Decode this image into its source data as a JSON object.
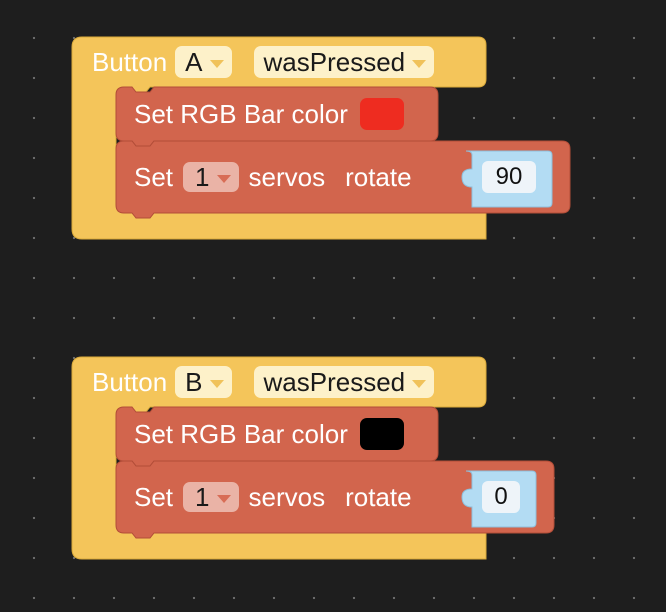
{
  "colors": {
    "event_block": "#f4c55a",
    "action_block": "#d2654d",
    "value_block": "#b3dcf3"
  },
  "blocks": [
    {
      "event": {
        "label": "Button",
        "button": "A",
        "action": "wasPressed"
      },
      "rgb": {
        "label": "Set RGB Bar color",
        "color": "#ee2c20"
      },
      "servo": {
        "set_label": "Set",
        "index": "1",
        "servos_label": "servos",
        "rotate_label": "rotate",
        "angle": "90"
      }
    },
    {
      "event": {
        "label": "Button",
        "button": "B",
        "action": "wasPressed"
      },
      "rgb": {
        "label": "Set RGB Bar color",
        "color": "#000000"
      },
      "servo": {
        "set_label": "Set",
        "index": "1",
        "servos_label": "servos",
        "rotate_label": "rotate",
        "angle": "0"
      }
    }
  ]
}
